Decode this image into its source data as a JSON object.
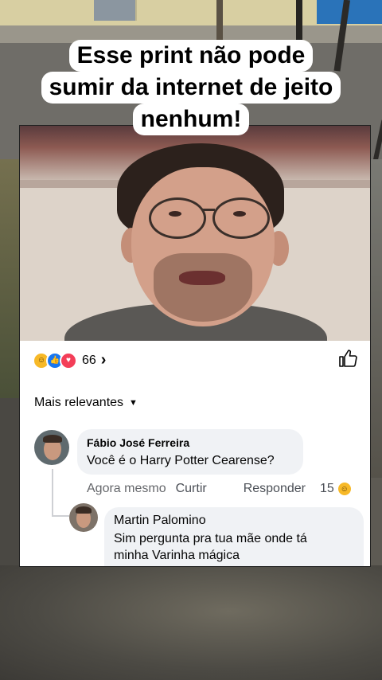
{
  "caption": {
    "lines": [
      "Esse print não pode",
      "sumir da internet de jeito",
      "nenhum!"
    ]
  },
  "post": {
    "reaction_count": "66",
    "sort_label": "Mais relevantes"
  },
  "comments": [
    {
      "author": "Fábio José Ferreira",
      "text": "Você é o Harry Potter Cearense?",
      "time": "Agora mesmo",
      "like_action": "Curtir",
      "reply_action": "Responder",
      "reaction_count": "15"
    }
  ],
  "reply": {
    "author": "Martin Palomino",
    "text_line1": "Sim pergunta pra tua mãe onde tá",
    "text_line2": "minha Varinha mágica"
  },
  "colors": {
    "fb_blue": "#1877f2",
    "bubble": "#f0f2f5",
    "meta_gray": "#65676b"
  },
  "icons": [
    "haha-reaction-icon",
    "like-reaction-icon",
    "love-reaction-icon",
    "chevron-right-icon",
    "thumbs-up-icon",
    "chevron-down-icon",
    "avatar-icon"
  ]
}
